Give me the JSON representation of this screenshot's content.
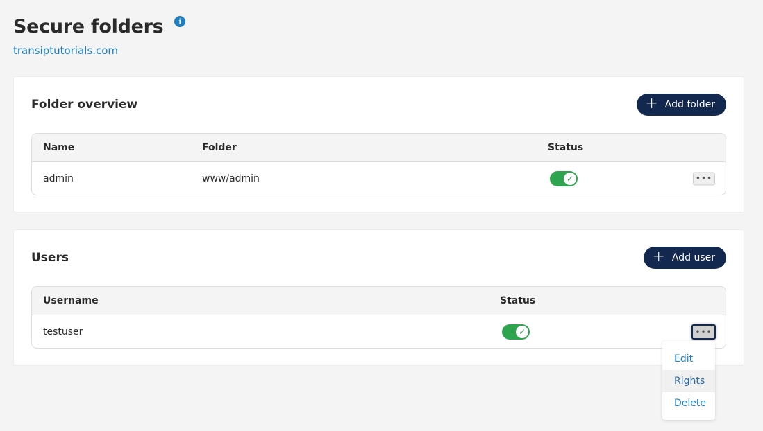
{
  "header": {
    "title": "Secure folders",
    "info_icon": "info-icon",
    "domain": "transiptutorials.com"
  },
  "folders": {
    "title": "Folder overview",
    "add_button": {
      "icon": "plus-icon",
      "label": "Add folder"
    },
    "columns": [
      "Name",
      "Folder",
      "Status"
    ],
    "rows": [
      {
        "name": "admin",
        "folder": "www/admin",
        "status_enabled": true,
        "more_icon": "ellipsis-icon"
      }
    ]
  },
  "users": {
    "title": "Users",
    "add_button": {
      "icon": "plus-icon",
      "label": "Add user"
    },
    "columns": [
      "Username",
      "Status"
    ],
    "rows": [
      {
        "username": "testuser",
        "status_enabled": true,
        "more_icon": "ellipsis-icon"
      }
    ]
  },
  "row_menu": {
    "items": [
      "Edit",
      "Rights",
      "Delete"
    ],
    "hovered": "Rights"
  },
  "colors": {
    "primary": "#13284f",
    "link": "#1f7fc2",
    "toggle_on": "#2ea44f",
    "background": "#f4f4f4"
  },
  "glyphs": {
    "info": "i",
    "plus": "+",
    "check": "✓",
    "ellipsis": "•••"
  }
}
